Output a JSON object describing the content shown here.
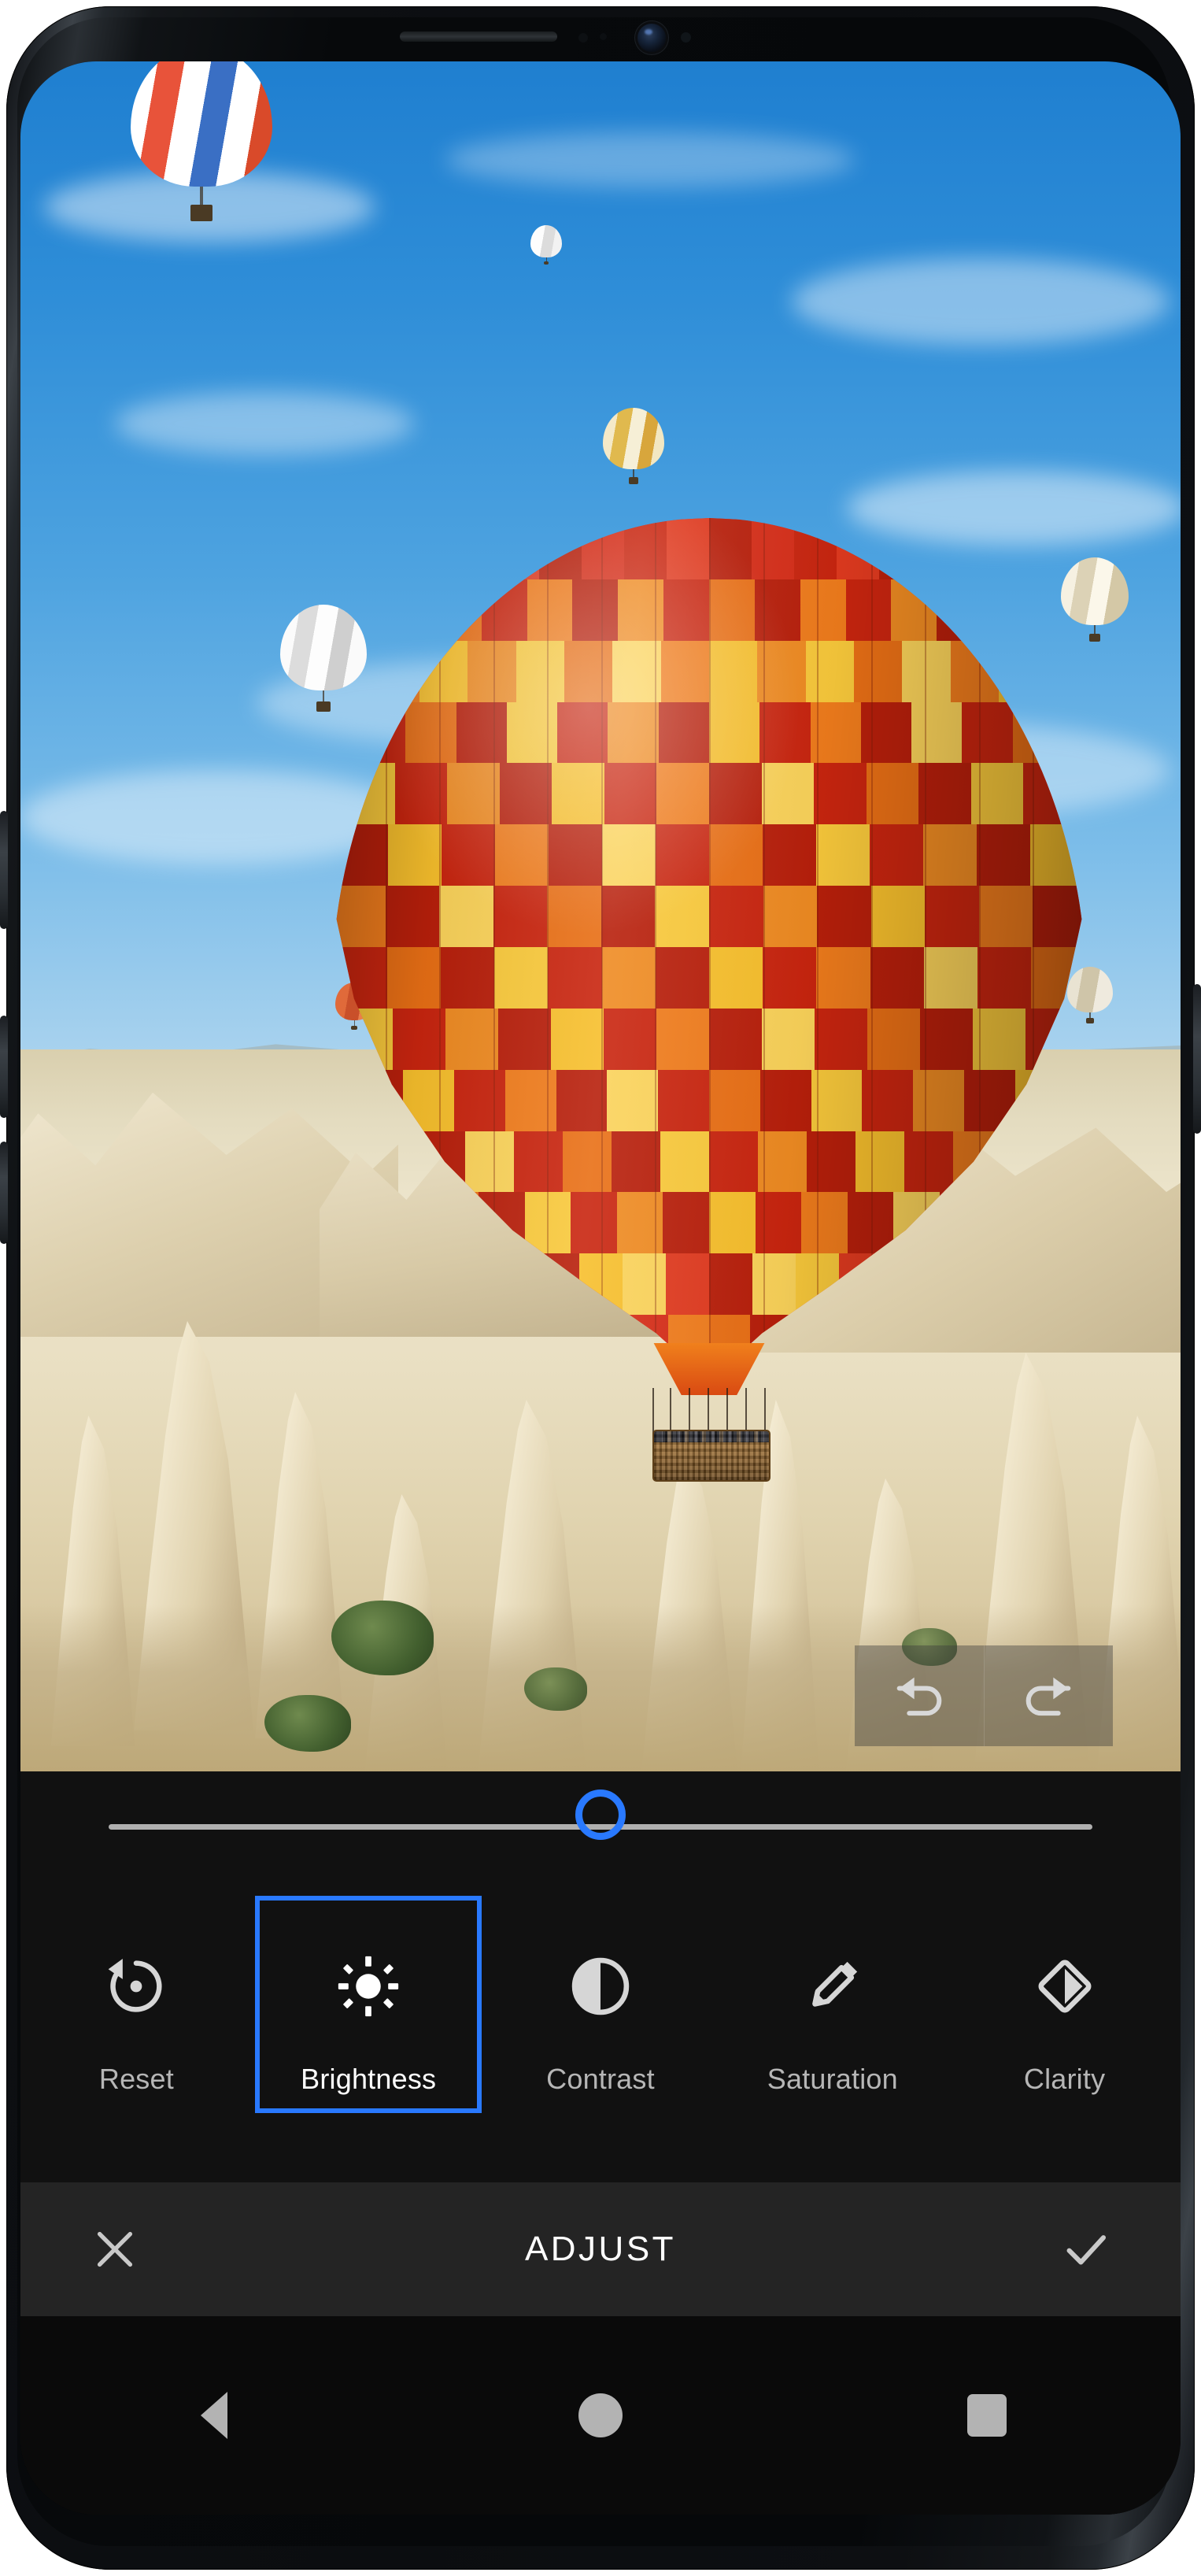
{
  "app": {
    "screen_title": "ADJUST",
    "photo_description": "Hot air balloons over Cappadocia rock formations"
  },
  "image_overlay": {
    "buttons": [
      {
        "name": "undo",
        "icon": "undo-icon"
      },
      {
        "name": "redo",
        "icon": "redo-icon"
      }
    ]
  },
  "slider": {
    "name": "brightness-slider",
    "min": 0,
    "max": 100,
    "value": 50,
    "track_color": "#b0b0b0",
    "thumb_color": "#2979ff"
  },
  "toolbar": {
    "accent_color": "#2979ff",
    "selected_index": 1,
    "tools": [
      {
        "label": "Reset",
        "icon": "reset-icon",
        "selected": false
      },
      {
        "label": "Brightness",
        "icon": "brightness-icon",
        "selected": true
      },
      {
        "label": "Contrast",
        "icon": "contrast-icon",
        "selected": false
      },
      {
        "label": "Saturation",
        "icon": "saturation-icon",
        "selected": false
      },
      {
        "label": "Clarity",
        "icon": "clarity-icon",
        "selected": false
      }
    ]
  },
  "bottom_bar": {
    "cancel_icon": "close-icon",
    "title": "ADJUST",
    "confirm_icon": "check-icon"
  },
  "navigation_bar": {
    "back_icon": "back-triangle-icon",
    "home_icon": "home-circle-icon",
    "recents_icon": "recents-square-icon"
  },
  "device": {
    "speaker": "earpiece-speaker",
    "front_camera": "front-camera-icon"
  }
}
